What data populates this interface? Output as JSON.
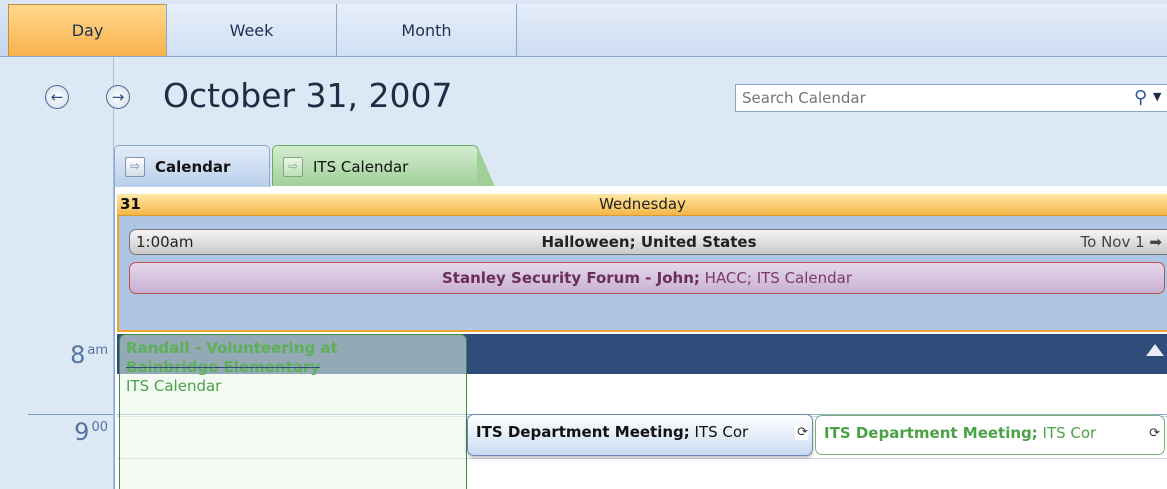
{
  "view_tabs": {
    "day": "Day",
    "week": "Week",
    "month": "Month"
  },
  "nav": {
    "prev_icon": "left-arrow-icon",
    "next_icon": "right-arrow-icon",
    "prev_glyph": "←",
    "next_glyph": "→"
  },
  "date_title": "October 31, 2007",
  "search": {
    "placeholder": "Search Calendar",
    "icon_glyph": "⚲",
    "dropdown_glyph": "▼"
  },
  "calendar_tabs": [
    {
      "label": "Calendar",
      "arrow_glyph": "⇨",
      "color": "#b9cfec"
    },
    {
      "label": "ITS Calendar",
      "arrow_glyph": "⇨",
      "color": "#9fd098"
    }
  ],
  "day_header": {
    "day_number": "31",
    "weekday": "Wednesday"
  },
  "all_day_events": [
    {
      "time": "1:00am",
      "subject": "Halloween; United States",
      "continues": "To Nov 1 ➡"
    },
    {
      "subject": "Stanley Security Forum - John;",
      "detail": " HACC; ITS Calendar"
    }
  ],
  "time_labels": [
    {
      "hour": "8",
      "suffix": "am"
    },
    {
      "hour": "9",
      "suffix": "00"
    }
  ],
  "events": {
    "volunteer": {
      "line1": "Randall - Volunteering at",
      "line2": "Bainbridge Elementary",
      "calendar": "ITS Calendar"
    },
    "meeting_blue": {
      "subject": "ITS Department Meeting;",
      "detail": " ITS Cor",
      "recur_glyph": "⟳"
    },
    "meeting_green": {
      "subject": "ITS Department Meeting;",
      "detail": " ITS Cor",
      "recur_glyph": "⟳"
    }
  },
  "colors": {
    "accent_orange": "#f5b646",
    "band_dark_blue": "#2e4d7b",
    "its_green": "#4ca147"
  }
}
